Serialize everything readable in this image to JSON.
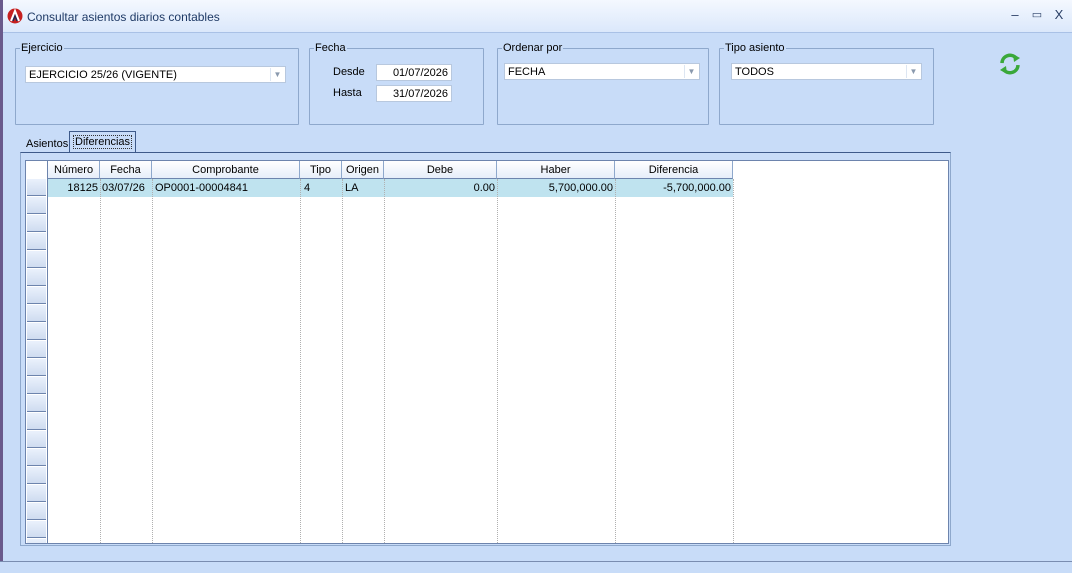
{
  "window": {
    "title": "Consultar asientos diarios contables",
    "controls": {
      "minimize": "–",
      "maximize": "▭",
      "close": "X"
    }
  },
  "filters": {
    "ejercicio": {
      "label": "Ejercicio",
      "value": "EJERCICIO 25/26 (VIGENTE)"
    },
    "fecha": {
      "label": "Fecha",
      "desde_label": "Desde",
      "desde_value": "01/07/2026",
      "hasta_label": "Hasta",
      "hasta_value": "31/07/2026"
    },
    "ordenar": {
      "label": "Ordenar por",
      "value": "FECHA"
    },
    "tipo": {
      "label": "Tipo asiento",
      "value": "TODOS"
    }
  },
  "tabs": [
    {
      "label": "Asientos"
    },
    {
      "label": "Diferencias"
    }
  ],
  "grid": {
    "columns": [
      "Número",
      "Fecha",
      "Comprobante",
      "Tipo",
      "Origen",
      "Debe",
      "Haber",
      "Diferencia"
    ],
    "rows": [
      {
        "numero": "18125",
        "fecha": "03/07/26",
        "comprobante": "OP0001-00004841",
        "tipo": "4",
        "origen": "LA",
        "debe": "0.00",
        "haber": "5,700,000.00",
        "diferencia": "-5,700,000.00"
      }
    ]
  },
  "colors": {
    "background": "#c8dcf8",
    "selected_row": "#bfe3ef",
    "refresh_icon": "#3aa83a"
  },
  "icons": {
    "app": "app-logo-icon",
    "refresh": "refresh-icon",
    "dropdown": "chevron-down-icon"
  }
}
